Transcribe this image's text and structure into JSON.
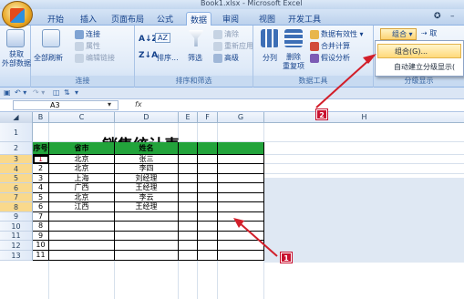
{
  "window": {
    "title": "Book1.xlsx - Microsoft Excel"
  },
  "tabs": [
    {
      "label": "开始",
      "active": false
    },
    {
      "label": "插入",
      "active": false
    },
    {
      "label": "页面布局",
      "active": false
    },
    {
      "label": "公式",
      "active": false
    },
    {
      "label": "数据",
      "active": true
    },
    {
      "label": "审阅",
      "active": false
    },
    {
      "label": "视图",
      "active": false
    },
    {
      "label": "开发工具",
      "active": false
    }
  ],
  "ribbon": {
    "get_external": "获取\n外部数据",
    "connections": {
      "refresh_all": "全部刷新",
      "connections": "连接",
      "properties": "属性",
      "edit_links": "编辑链接",
      "label": "连接"
    },
    "sort_filter": {
      "sort": "排序...",
      "filter": "筛选",
      "clear": "清除",
      "reapply": "重新应用",
      "advanced": "高级",
      "label": "排序和筛选"
    },
    "data_tools": {
      "text_to_columns": "分列",
      "remove_duplicates": "删除\n重复项",
      "data_validation": "数据有效性",
      "consolidate": "合并计算",
      "what_if": "假设分析",
      "label": "数据工具"
    },
    "outline": {
      "group": "组合",
      "ungroup": "取",
      "label": "分级显示"
    }
  },
  "group_menu": [
    {
      "label": "组合(G)...",
      "highlighted": true
    },
    {
      "label": "自动建立分级显示(",
      "highlighted": false
    }
  ],
  "namebox": "A3",
  "fx": "fx",
  "columns": [
    "A",
    "B",
    "C",
    "D",
    "E",
    "F",
    "G",
    "H"
  ],
  "rows": [
    "1",
    "2",
    "3",
    "4",
    "5",
    "6",
    "7",
    "8",
    "9",
    "10",
    "11",
    "12",
    "13"
  ],
  "sheet_title": "销售统计表一",
  "table_headers": [
    "序号",
    "省市",
    "姓名"
  ],
  "table_rows": [
    [
      "1",
      "北京",
      "张三"
    ],
    [
      "2",
      "北京",
      "李四"
    ],
    [
      "3",
      "上海",
      "刘经理"
    ],
    [
      "4",
      "广西",
      "王经理"
    ],
    [
      "5",
      "北京",
      "李云"
    ],
    [
      "6",
      "江西",
      "王经理"
    ],
    [
      "7",
      "",
      ""
    ],
    [
      "8",
      "",
      ""
    ],
    [
      "9",
      "",
      ""
    ],
    [
      "10",
      "",
      ""
    ],
    [
      "11",
      "",
      ""
    ]
  ],
  "badges": {
    "one": "1",
    "two": "2"
  },
  "colors": {
    "header_green": "#22a33b",
    "arrow_red": "#d21f2a",
    "badge_red": "#c8102e",
    "ribbon_blue": "#dfeaf8"
  }
}
